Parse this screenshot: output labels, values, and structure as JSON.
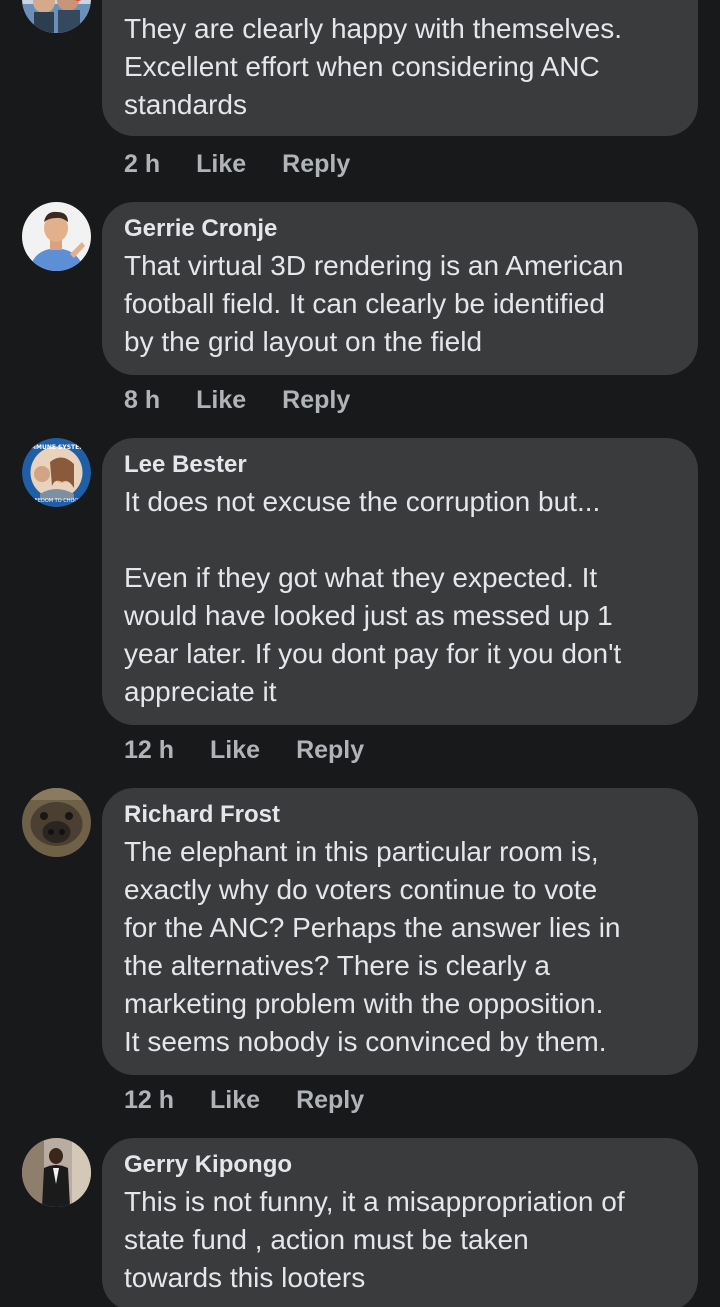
{
  "colors": {
    "background": "#18191a",
    "bubble": "#3a3b3c",
    "text": "#e4e6eb",
    "secondary_text": "#b0b3b8"
  },
  "comments": [
    {
      "author": "",
      "text": "They are clearly happy with themselves.\nExcellent effort when considering ANC\nstandards",
      "time": "2 h",
      "like": "Like",
      "reply": "Reply",
      "avatar_icon": "group-photo-avatar-icon"
    },
    {
      "author": "Gerrie Cronje",
      "text": "That virtual 3D rendering is an American\nfootball field. It can clearly be identified\nby the grid layout on the field",
      "time": "8 h",
      "like": "Like",
      "reply": "Reply",
      "avatar_icon": "man-in-blue-shirt-avatar-icon"
    },
    {
      "author": "Lee Bester",
      "text": "It does not excuse the corruption but...\n\nEven if they got what they expected. It\nwould have looked just as messed up 1\nyear later. If you dont pay for it you don't\nappreciate it",
      "time": "12 h",
      "like": "Like",
      "reply": "Reply",
      "avatar_icon": "badge-frame-avatar-icon",
      "avatar_badge_top": "I TRUST MY IMMUNE SYSTEM",
      "avatar_badge_bottom": "FREEDOM TO CHOOSE"
    },
    {
      "author": "Richard Frost",
      "text": "The elephant in this particular room is,\nexactly why do voters continue to vote\nfor the ANC? Perhaps the answer lies in\nthe alternatives? There is clearly a\nmarketing problem with the opposition.\nIt seems nobody is convinced by them.",
      "time": "12 h",
      "like": "Like",
      "reply": "Reply",
      "avatar_icon": "animal-face-avatar-icon"
    },
    {
      "author": "Gerry Kipongo",
      "text": "This is not funny, it a misappropriation of\nstate fund , action must be taken\ntowards this looters",
      "time": "",
      "like": "",
      "reply": "",
      "avatar_icon": "man-in-suit-avatar-icon"
    }
  ]
}
